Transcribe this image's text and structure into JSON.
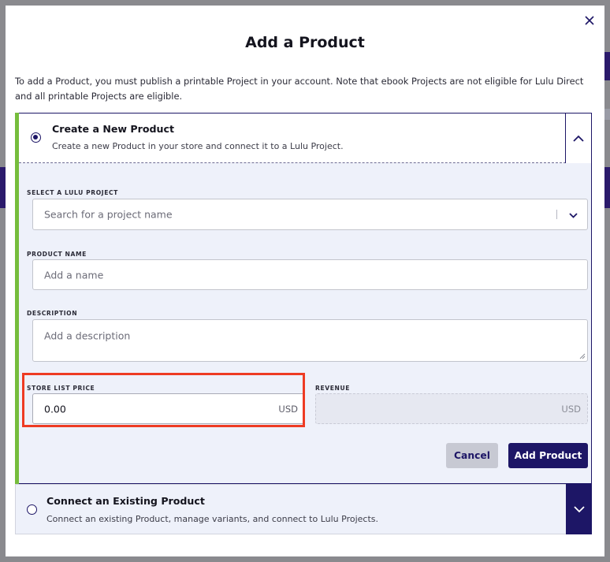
{
  "modal": {
    "title": "Add a Product",
    "intro": "To add a Product, you must publish a printable Project in your account. Note that ebook Projects are not eligible for Lulu Direct and all printable Projects are eligible."
  },
  "create_new": {
    "title": "Create a New Product",
    "subtitle": "Create a new Product in your store and connect it to a Lulu Project.",
    "selected": true,
    "project": {
      "label": "SELECT A LULU PROJECT",
      "placeholder": "Search for a project name"
    },
    "product_name": {
      "label": "PRODUCT NAME",
      "placeholder": "Add a name"
    },
    "description": {
      "label": "DESCRIPTION",
      "placeholder": "Add a description"
    },
    "store_list_price": {
      "label": "STORE LIST PRICE",
      "value": "0.00",
      "currency": "USD"
    },
    "revenue": {
      "label": "REVENUE",
      "value": "",
      "currency": "USD"
    },
    "buttons": {
      "cancel": "Cancel",
      "add": "Add Product"
    }
  },
  "connect_existing": {
    "title": "Connect an Existing Product",
    "subtitle": "Connect an existing Product, manage variants, and connect to Lulu Projects.",
    "selected": false
  },
  "icons": {
    "close": "close-icon",
    "collapse": "chevron-up-icon",
    "expand": "chevron-down-icon"
  },
  "colors": {
    "brand": "#1d1666",
    "accent_green": "#76bd3c",
    "highlight": "#ee3b23"
  }
}
